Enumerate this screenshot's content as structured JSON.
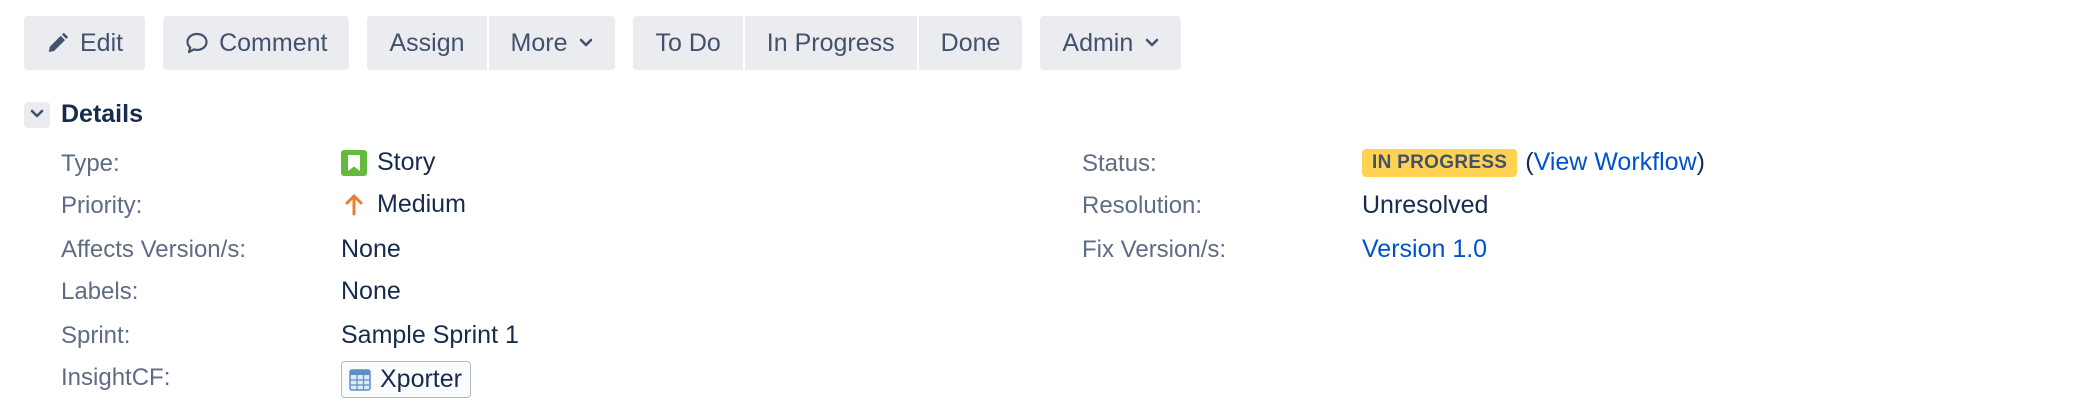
{
  "toolbar": {
    "edit_label": "Edit",
    "comment_label": "Comment",
    "assign_label": "Assign",
    "more_label": "More",
    "todo_label": "To Do",
    "in_progress_label": "In Progress",
    "done_label": "Done",
    "admin_label": "Admin",
    "icons": {
      "edit": "pencil-icon",
      "comment": "speech-bubble-icon",
      "dropdown": "chevron-down-icon"
    }
  },
  "details": {
    "title": "Details",
    "toggle_icon": "chevron-down-icon",
    "left": {
      "type_label": "Type:",
      "type_value": "Story",
      "type_icon": "story-bookmark-icon",
      "priority_label": "Priority:",
      "priority_value": "Medium",
      "priority_icon": "arrow-up-icon",
      "affects_label": "Affects Version/s:",
      "affects_value": "None",
      "labels_label": "Labels:",
      "labels_value": "None",
      "sprint_label": "Sprint:",
      "sprint_value": "Sample Sprint 1",
      "insight_label": "InsightCF:",
      "insight_value": "Xporter",
      "insight_icon": "table-icon"
    },
    "right": {
      "status_label": "Status:",
      "status_value": "IN PROGRESS",
      "view_workflow_open": "(",
      "view_workflow_label": "View Workflow",
      "view_workflow_close": ")",
      "resolution_label": "Resolution:",
      "resolution_value": "Unresolved",
      "fix_label": "Fix Version/s:",
      "fix_value": "Version 1.0"
    }
  },
  "colors": {
    "button_bg": "#ebecf0",
    "text_primary": "#172b4d",
    "text_secondary": "#5e6c84",
    "link": "#0052cc",
    "status_in_progress": "#ffd351",
    "story_green": "#63ba3c",
    "priority_medium": "#e97f33"
  }
}
